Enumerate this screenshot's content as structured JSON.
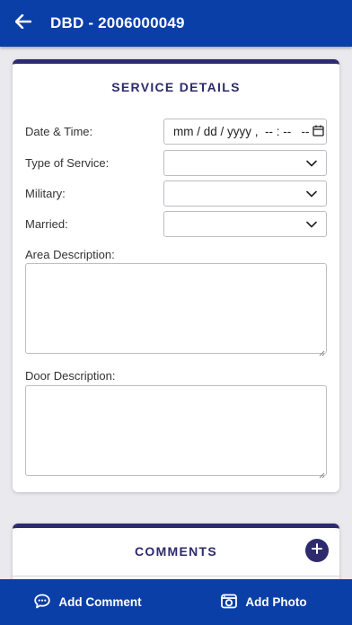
{
  "header": {
    "title": "DBD - 2006000049",
    "back_icon": "arrow-left-icon"
  },
  "service_details": {
    "title": "SERVICE DETAILS",
    "date_time": {
      "label": "Date & Time:",
      "placeholder": "mm / dd / yyyy ,  -- : --   -- ",
      "icon": "calendar-icon"
    },
    "type_of_service": {
      "label": "Type of Service:",
      "value": "",
      "icon": "chevron-down-icon"
    },
    "military": {
      "label": "Military:",
      "value": "",
      "icon": "chevron-down-icon"
    },
    "married": {
      "label": "Married:",
      "value": "",
      "icon": "chevron-down-icon"
    },
    "area_description": {
      "label": "Area Description:",
      "value": ""
    },
    "door_description": {
      "label": "Door Description:",
      "value": ""
    }
  },
  "comments": {
    "title": "COMMENTS",
    "add_icon": "plus-circle-icon"
  },
  "bottom_bar": {
    "add_comment": {
      "label": "Add Comment",
      "icon": "chat-bubble-icon"
    },
    "add_photo": {
      "label": "Add Photo",
      "icon": "camera-icon"
    }
  },
  "colors": {
    "primary": "#0b3fa8",
    "accent": "#2d2a6e",
    "background": "#e9e9ee"
  }
}
